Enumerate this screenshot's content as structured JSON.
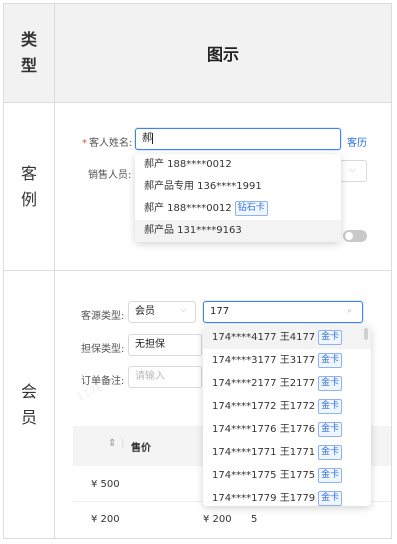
{
  "header": {
    "type_label": [
      "类",
      "型"
    ],
    "title": "图示"
  },
  "row_customer": {
    "label": [
      "客",
      "例"
    ],
    "name_label": "客人姓名:",
    "name_value": "郝",
    "history_link": "客历",
    "sales_label": "销售人员:",
    "suggestions": [
      {
        "text": "郝产 188****0012",
        "tag": ""
      },
      {
        "text": "郝产品专用 136****1991",
        "tag": ""
      },
      {
        "text": "郝产 188****0012",
        "tag": "钻石卡"
      },
      {
        "text": "郝产品 131****9163",
        "tag": ""
      }
    ]
  },
  "row_member": {
    "label": [
      "会",
      "员"
    ],
    "source_label": "客源类型:",
    "source_value": "会员",
    "search_value": "177",
    "guarantee_label": "担保类型:",
    "guarantee_value": "无担保",
    "remark_label": "订单备注:",
    "remark_placeholder": "请输入",
    "price_header": "售价",
    "price_rows": [
      "¥ 500",
      "¥ 200"
    ],
    "row2_price2": "¥ 200",
    "row2_qty": "5",
    "results": [
      {
        "text": "174****4177 王4177",
        "tag": "金卡"
      },
      {
        "text": "174****3177 王3177",
        "tag": "金卡"
      },
      {
        "text": "174****2177 王2177",
        "tag": "金卡"
      },
      {
        "text": "174****1772 王1772",
        "tag": "金卡"
      },
      {
        "text": "174****1776 王1776",
        "tag": "金卡"
      },
      {
        "text": "174****1771 王1771",
        "tag": "金卡"
      },
      {
        "text": "174****1775 王1775",
        "tag": "金卡"
      },
      {
        "text": "174****1779 王1779",
        "tag": "金卡"
      }
    ]
  },
  "icons": {
    "search": "search-icon",
    "sort": "sort-icon",
    "caret": "chevron-down-icon"
  }
}
